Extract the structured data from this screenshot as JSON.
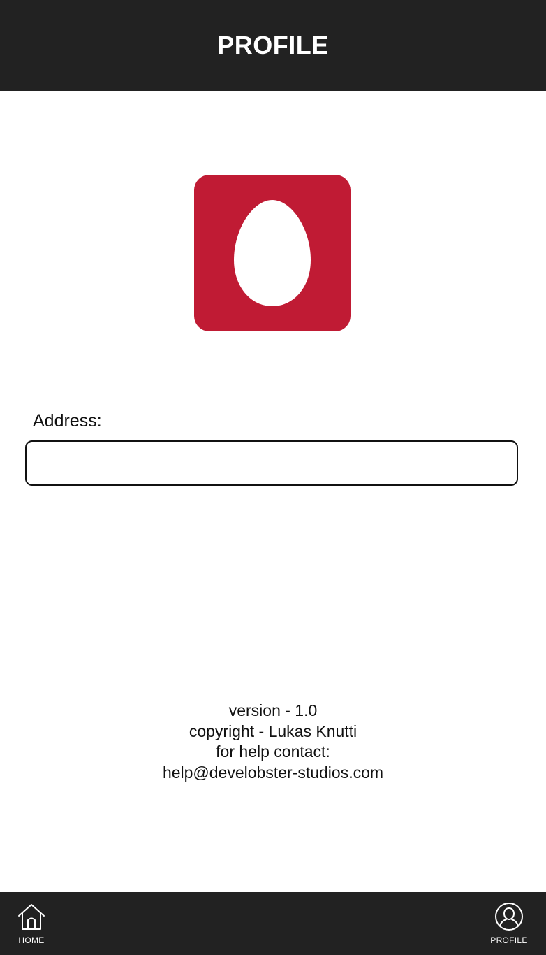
{
  "header": {
    "title": "PROFILE"
  },
  "avatar": {
    "icon": "egg-icon",
    "background_color": "#c01b34"
  },
  "address": {
    "label": "Address:",
    "value": "",
    "placeholder": ""
  },
  "info": {
    "version": "version - 1.0",
    "copyright": "copyright - Lukas Knutti",
    "help_label": "for help contact:",
    "help_email": "help@develobster-studios.com"
  },
  "bottom_nav": {
    "home_label": "HOME",
    "home_icon": "home-icon",
    "profile_label": "PROFILE",
    "profile_icon": "user-icon"
  },
  "colors": {
    "bar": "#222222",
    "accent": "#c01b34"
  }
}
